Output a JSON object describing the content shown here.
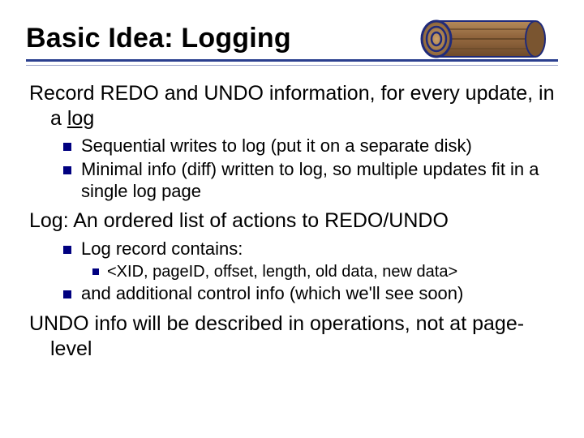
{
  "title": "Basic Idea: Logging",
  "log_icon_label": "log-icon",
  "body": {
    "p1a": "Record REDO and UNDO information, for every update, in a ",
    "p1b": "log",
    "b1": "Sequential writes to log (put it on a separate disk)",
    "b2": "Minimal info (diff) written to log, so multiple updates fit in a single log page",
    "p2": "Log: An ordered list of actions to REDO/UNDO",
    "b3": "Log record contains:",
    "b3a": "<XID, pageID, offset, length, old data, new data>",
    "b4": "and additional control info (which we'll see soon)",
    "p3": "UNDO info will be described in operations, not at page-level"
  }
}
